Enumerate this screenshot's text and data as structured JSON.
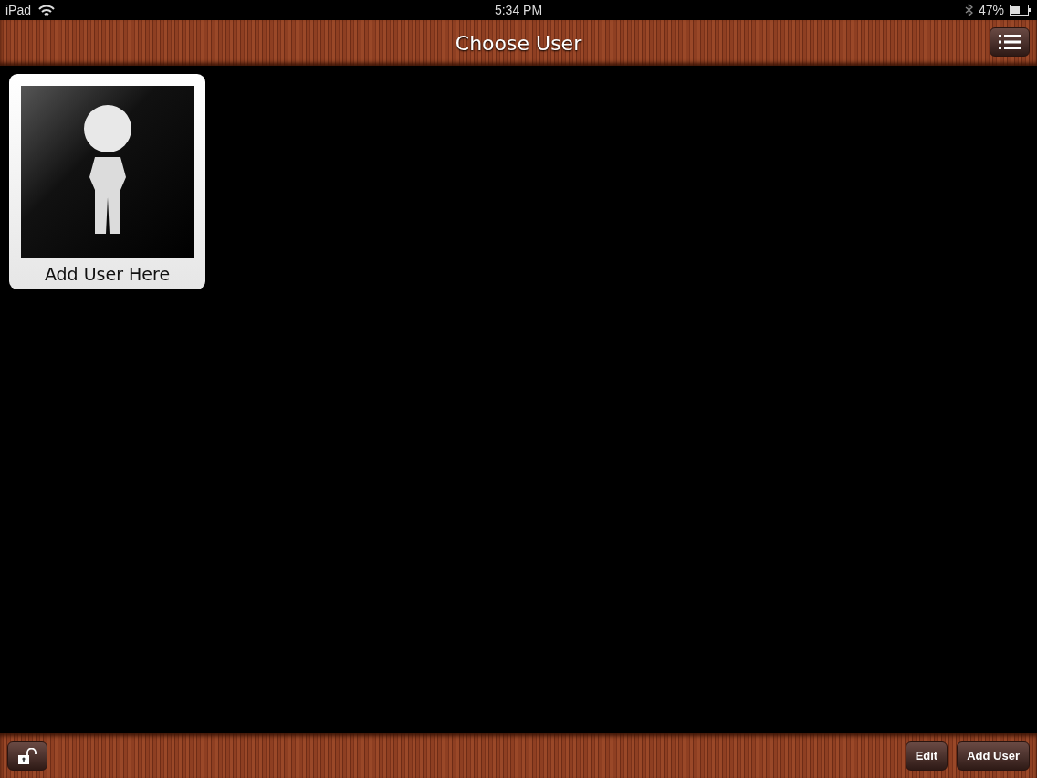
{
  "status_bar": {
    "device": "iPad",
    "time": "5:34 PM",
    "battery": "47%"
  },
  "nav_bar": {
    "title": "Choose User"
  },
  "users": [
    {
      "label": "Add User Here"
    }
  ],
  "toolbar": {
    "buttons": [
      "Edit",
      "Add User"
    ]
  }
}
